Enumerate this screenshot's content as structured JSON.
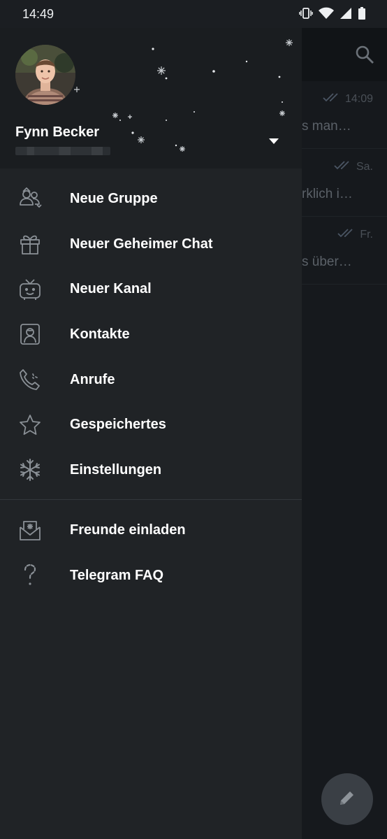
{
  "status_bar": {
    "time": "14:49",
    "icons": [
      "vibrate-icon",
      "wifi-icon",
      "signal-icon",
      "battery-icon"
    ]
  },
  "drawer": {
    "user_name": "Fynn Becker",
    "menu": [
      {
        "label": "Neue Gruppe",
        "icon": "new-group-icon"
      },
      {
        "label": "Neuer Geheimer Chat",
        "icon": "gift-icon"
      },
      {
        "label": "Neuer Kanal",
        "icon": "channel-tv-icon"
      },
      {
        "label": "Kontakte",
        "icon": "contacts-icon"
      },
      {
        "label": "Anrufe",
        "icon": "calls-icon"
      },
      {
        "label": "Gespeichertes",
        "icon": "star-icon"
      },
      {
        "label": "Einstellungen",
        "icon": "snowflake-icon"
      }
    ],
    "menu_secondary": [
      {
        "label": "Freunde einladen",
        "icon": "invite-envelope-icon"
      },
      {
        "label": "Telegram FAQ",
        "icon": "candy-cane-question-icon"
      }
    ]
  },
  "background_chats": [
    {
      "time": "14:09",
      "preview": "s man…"
    },
    {
      "time": "Sa.",
      "preview": "rklich i…"
    },
    {
      "time": "Fr.",
      "preview": "s über…"
    }
  ],
  "colors": {
    "drawer_bg": "#202326",
    "header_bg": "#1a1d20",
    "icon_stroke": "#8a9096",
    "text": "#ffffff"
  }
}
